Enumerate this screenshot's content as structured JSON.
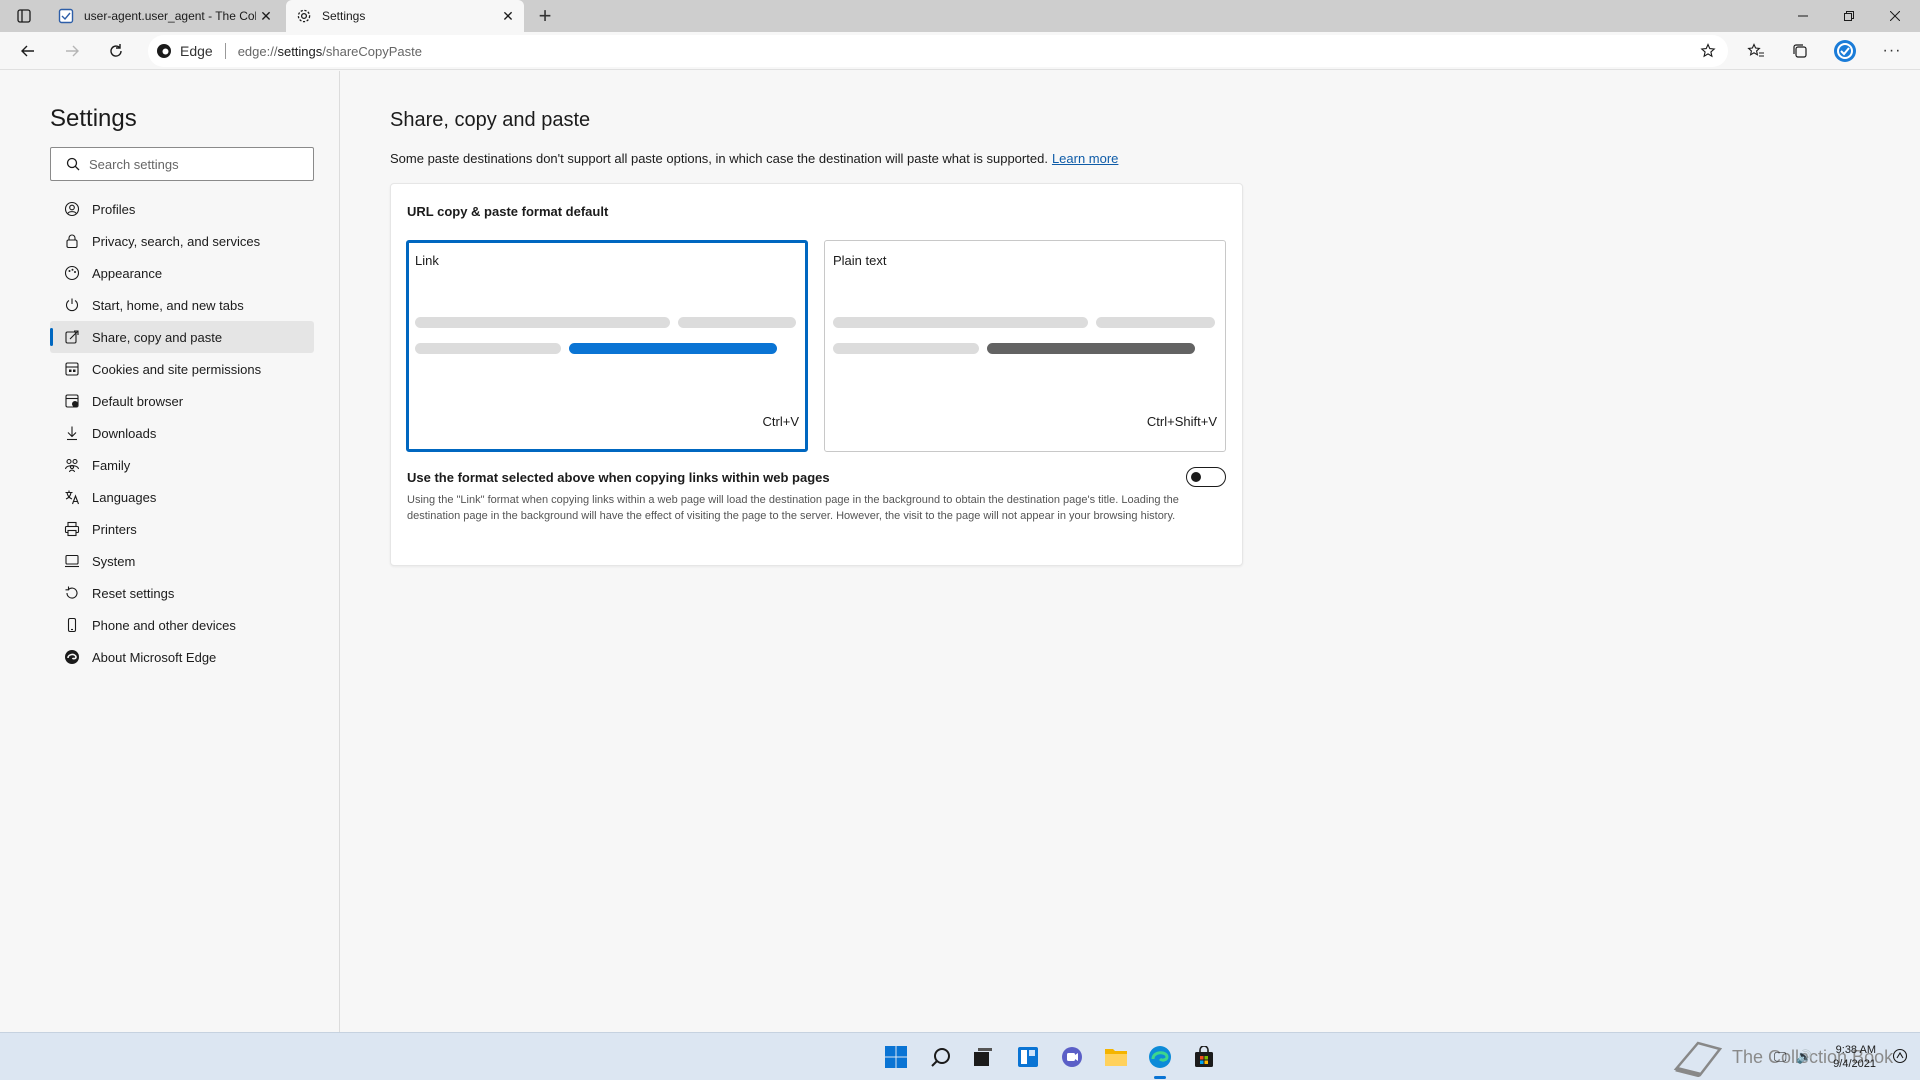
{
  "colors": {
    "accent": "#0067c0",
    "selected_bar": "#0a74d4",
    "plain_bar": "#636363",
    "light_bar": "#dcdcdc"
  },
  "tabs": [
    {
      "title": "user-agent.user_agent - The Coll",
      "icon": "document-icon",
      "active": false
    },
    {
      "title": "Settings",
      "icon": "gear-icon",
      "active": true
    }
  ],
  "address": {
    "badge": "Edge",
    "url_prefix": "edge://",
    "url_bold": "settings",
    "url_rest": "/shareCopyPaste"
  },
  "sidebar": {
    "title": "Settings",
    "search_placeholder": "Search settings",
    "items": [
      {
        "label": "Profiles",
        "icon": "profile-icon"
      },
      {
        "label": "Privacy, search, and services",
        "icon": "lock-icon"
      },
      {
        "label": "Appearance",
        "icon": "appearance-icon"
      },
      {
        "label": "Start, home, and new tabs",
        "icon": "power-icon"
      },
      {
        "label": "Share, copy and paste",
        "icon": "share-icon",
        "selected": true
      },
      {
        "label": "Cookies and site permissions",
        "icon": "cookies-icon"
      },
      {
        "label": "Default browser",
        "icon": "browser-icon"
      },
      {
        "label": "Downloads",
        "icon": "download-icon"
      },
      {
        "label": "Family",
        "icon": "family-icon"
      },
      {
        "label": "Languages",
        "icon": "languages-icon"
      },
      {
        "label": "Printers",
        "icon": "printer-icon"
      },
      {
        "label": "System",
        "icon": "system-icon"
      },
      {
        "label": "Reset settings",
        "icon": "reset-icon"
      },
      {
        "label": "Phone and other devices",
        "icon": "phone-icon"
      },
      {
        "label": "About Microsoft Edge",
        "icon": "edge-icon"
      }
    ]
  },
  "main": {
    "title": "Share, copy and paste",
    "description": "Some paste destinations don't support all paste options, in which case the destination will paste what is supported.",
    "learn_more": "Learn more",
    "card": {
      "title": "URL copy & paste format default",
      "options": [
        {
          "label": "Link",
          "shortcut": "Ctrl+V",
          "selected": true
        },
        {
          "label": "Plain text",
          "shortcut": "Ctrl+Shift+V",
          "selected": false
        }
      ],
      "toggle_title": "Use the format selected above when copying links within web pages",
      "toggle_description": "Using the \"Link\" format when copying links within a web page will load the destination page in the background to obtain the destination page's title. Loading the destination page in the background will have the effect of visiting the page to the server. However, the visit to the page will not appear in your browsing history.",
      "toggle_on": false
    }
  },
  "taskbar": {
    "icons": [
      "windows-start-icon",
      "search-icon",
      "task-view-icon",
      "widgets-icon",
      "chat-icon",
      "file-explorer-icon",
      "edge-icon",
      "store-icon"
    ],
    "time": "9:38 AM",
    "date": "9/4/2021",
    "watermark": "The Collection Book"
  }
}
